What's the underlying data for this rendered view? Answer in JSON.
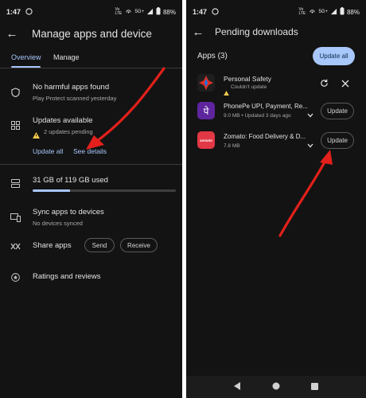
{
  "left": {
    "status": {
      "time": "1:47",
      "battery": "88%",
      "net": "5G+",
      "volte": "Vo LTE"
    },
    "title": "Manage apps and device",
    "tabs": [
      "Overview",
      "Manage"
    ],
    "protect": {
      "title": "No harmful apps found",
      "sub": "Play Protect scanned yesterday"
    },
    "updates": {
      "title": "Updates available",
      "sub": "2 updates pending",
      "update_all": "Update all",
      "see_details": "See details"
    },
    "storage": {
      "text": "31 GB of 119 GB used",
      "used_gb": 31,
      "total_gb": 119
    },
    "sync": {
      "title": "Sync apps to devices",
      "sub": "No devices synced"
    },
    "share": {
      "title": "Share apps",
      "send": "Send",
      "receive": "Receive"
    },
    "ratings": {
      "title": "Ratings and reviews"
    }
  },
  "right": {
    "status": {
      "time": "1:47",
      "battery": "88%",
      "net": "5G+",
      "volte": "Vo LTE"
    },
    "title": "Pending downloads",
    "section": "Apps (3)",
    "update_all": "Update all",
    "apps": [
      {
        "name": "Personal Safety",
        "sub": "Couldn't update",
        "icon": "personal-safety-logo"
      },
      {
        "name": "PhonePe UPI, Payment, Re...",
        "sub": "9.0 MB • Updated 3 days ago",
        "icon": "phonepe-logo",
        "action": "Update",
        "logo_text": "पे"
      },
      {
        "name": "Zomato: Food Delivery & D...",
        "sub": "7.8 MB",
        "icon": "zomato-logo",
        "action": "Update",
        "logo_text": "zomato"
      }
    ]
  },
  "colors": {
    "background": "#131313",
    "accent": "#a8c7fa",
    "annotation_arrow": "#e3201b",
    "warning": "#f2c94c"
  }
}
